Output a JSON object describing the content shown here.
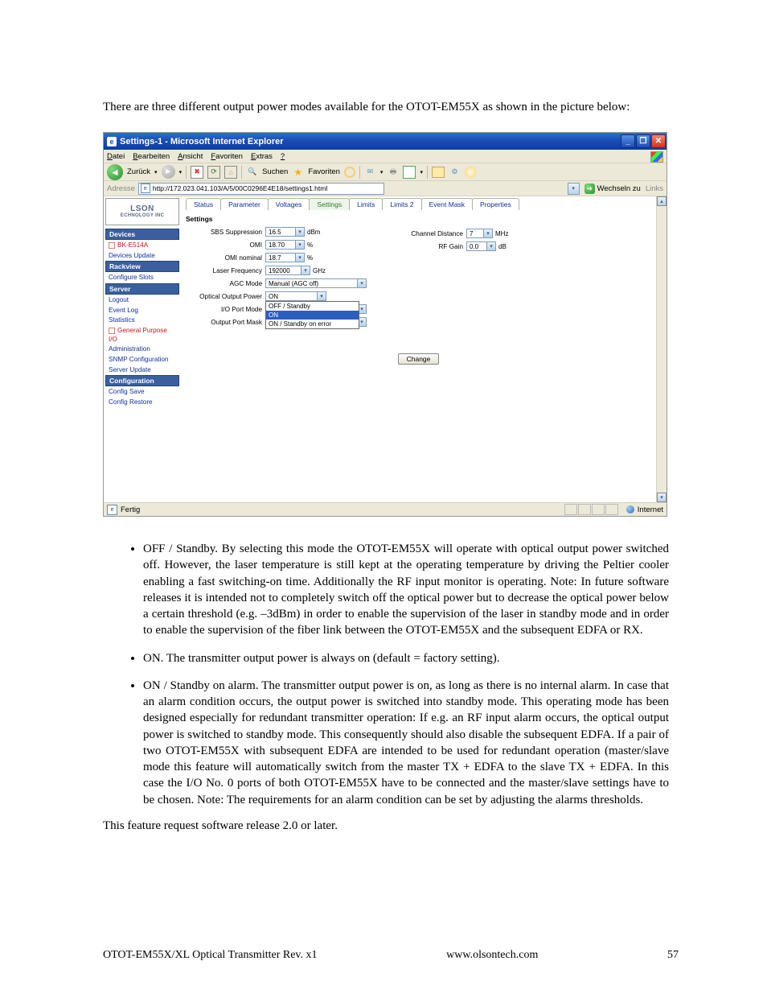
{
  "doc": {
    "intro": "There are three different output power modes available for the OTOT-EM55X as shown in the picture below:",
    "closing": "This feature request software release 2.0 or later.",
    "footer_left": "OTOT-EM55X/XL Optical Transmitter Rev. x1",
    "footer_center": "www.olsontech.com",
    "footer_page": "57"
  },
  "bullets": {
    "b1": "OFF / Standby. By selecting this mode the OTOT-EM55X will operate with optical output power switched off. However, the laser temperature is still kept at the operating temperature by driving the Peltier cooler enabling a fast switching-on time. Additionally the RF input monitor is operating. Note: In future software releases it is intended not to completely switch off the optical power but to decrease the optical power below a certain threshold (e.g. –3dBm) in order to enable the supervision of the laser in standby mode and in order to enable the supervision of the fiber link between the OTOT-EM55X and the subsequent EDFA or RX.",
    "b2": "ON. The transmitter output power is always on (default = factory setting).",
    "b3": "ON / Standby on alarm. The transmitter output power is on, as long as there is no internal alarm. In case that an alarm condition occurs, the output power is switched into standby mode. This operating mode has been designed especially for redundant transmitter operation: If e.g. an RF input alarm occurs, the optical output power is switched to standby mode. This consequently should also disable the subsequent EDFA. If a pair of two OTOT-EM55X with subsequent EDFA are intended to be used for redundant operation (master/slave mode this feature will automatically switch from the master TX + EDFA to the slave TX + EDFA. In this case the I/O No. 0 ports of both OTOT-EM55X have to be connected and the master/slave settings have to be chosen. Note: The requirements for an alarm condition can be set by adjusting the alarms thresholds."
  },
  "window": {
    "title": "Settings-1 - Microsoft Internet Explorer",
    "menu": {
      "m1": "Datei",
      "m2": "Bearbeiten",
      "m3": "Ansicht",
      "m4": "Favoriten",
      "m5": "Extras",
      "m6": "?"
    },
    "toolbar": {
      "back": "Zurück",
      "search": "Suchen",
      "fav": "Favoriten"
    },
    "address": {
      "label": "Adresse",
      "url": "http://172.023.041.103/A/5/00C0296E4E18/settings1.html",
      "go": "Wechseln zu",
      "links": "Links"
    },
    "status": {
      "left": "Fertig",
      "right": "Internet"
    }
  },
  "logo": {
    "l1": "LSON",
    "l2": "ECHNOLOGY INC"
  },
  "sidebar": {
    "cat_devices": "Devices",
    "item_dev1": "BK-E514A",
    "item_dev2": "Devices Update",
    "cat_rack": "Rackview",
    "item_rack1": "Configure Slots",
    "cat_server": "Server",
    "item_s1": "Logout",
    "item_s2": "Event Log",
    "item_s3": "Statistics",
    "item_s4": "General Purpose I/O",
    "item_s5": "Administration",
    "item_s6": "SNMP Configuration",
    "item_s7": "Server Update",
    "cat_config": "Configuration",
    "item_c1": "Config Save",
    "item_c2": "Config Restore"
  },
  "tabs": {
    "t1": "Status",
    "t2": "Parameter",
    "t3": "Voltages",
    "t4": "Settings",
    "t5": "Limits",
    "t6": "Limits 2",
    "t7": "Event Mask",
    "t8": "Properties"
  },
  "panel": {
    "subtitle": "Settings",
    "labels": {
      "sbs": "SBS Suppression",
      "omi": "OMI",
      "omin": "OMI nominal",
      "lfreq": "Laser Frequency",
      "agc": "AGC Mode",
      "oop": "Optical Output Power",
      "iop": "I/O Port Mode",
      "opm": "Output Port Mask",
      "chan": "Channel Distance",
      "rfg": "RF Gain"
    },
    "values": {
      "sbs": "16.5",
      "omi": "18.70",
      "omin": "18.7",
      "lfreq": "192000",
      "agc": "Manual (AGC off)",
      "oop": "ON",
      "chan": "7",
      "rfg": "0.0"
    },
    "units": {
      "sbs": "dBm",
      "omi": "%",
      "omin": "%",
      "lfreq": "GHz",
      "chan": "MHz",
      "rfg": "dB"
    },
    "dd_items": {
      "i1": "OFF / Standby",
      "i2": "ON",
      "i3": "ON / Standby on error"
    },
    "change": "Change"
  }
}
